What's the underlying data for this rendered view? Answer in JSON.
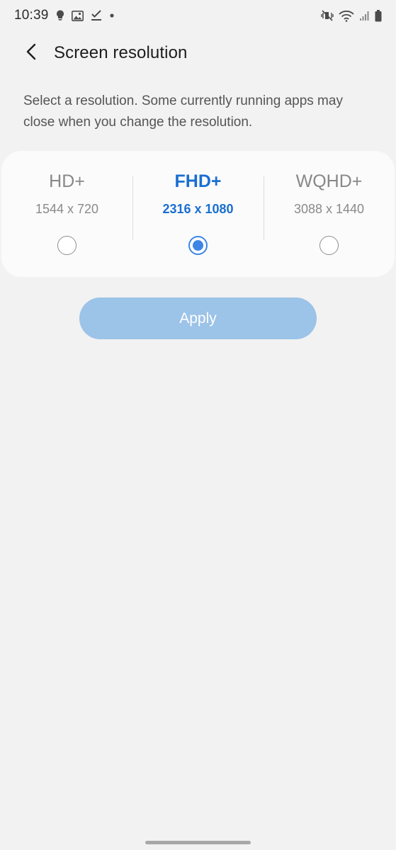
{
  "status_bar": {
    "time": "10:39",
    "left_icons": [
      "lightbulb-icon",
      "image-icon",
      "check-download-icon",
      "dot-icon"
    ],
    "right_icons": [
      "mute-vibrate-icon",
      "wifi-icon",
      "signal-icon",
      "battery-icon"
    ]
  },
  "header": {
    "back_icon": "chevron-left-icon",
    "title": "Screen resolution"
  },
  "description": "Select a resolution. Some currently running apps may close when you change the resolution.",
  "options": [
    {
      "name": "HD+",
      "resolution": "1544 x 720",
      "selected": false
    },
    {
      "name": "FHD+",
      "resolution": "2316 x 1080",
      "selected": true
    },
    {
      "name": "WQHD+",
      "resolution": "3088 x 1440",
      "selected": false
    }
  ],
  "apply_button": {
    "label": "Apply",
    "enabled": false
  },
  "colors": {
    "accent": "#1a6fd1",
    "radio_selected": "#3d86e6",
    "apply_disabled": "#9cc3e8",
    "background": "#f2f2f2",
    "card": "#fbfbfb"
  }
}
